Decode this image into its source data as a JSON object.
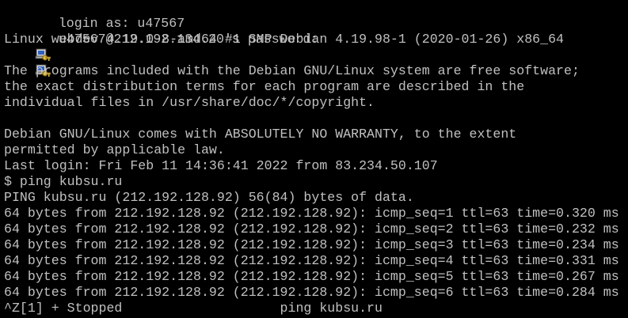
{
  "terminal": {
    "background": "#000000",
    "foreground": "#c0c0c0",
    "login_icon": "key-icon",
    "lines": [
      {
        "text": "login as: u47567",
        "icon": true
      },
      {
        "text": "u47567@212.192.134.20's password:",
        "icon": true
      },
      {
        "text": "Linux webdev 4.19.0-8-amd64 #1 SMP Debian 4.19.98-1 (2020-01-26) x86_64"
      },
      {
        "text": ""
      },
      {
        "text": "The programs included with the Debian GNU/Linux system are free software;"
      },
      {
        "text": "the exact distribution terms for each program are described in the"
      },
      {
        "text": "individual files in /usr/share/doc/*/copyright."
      },
      {
        "text": ""
      },
      {
        "text": "Debian GNU/Linux comes with ABSOLUTELY NO WARRANTY, to the extent"
      },
      {
        "text": "permitted by applicable law."
      },
      {
        "text": "Last login: Fri Feb 11 14:36:41 2022 from 83.234.50.107"
      },
      {
        "text": "$ ping kubsu.ru"
      },
      {
        "text": "PING kubsu.ru (212.192.128.92) 56(84) bytes of data."
      },
      {
        "text": "64 bytes from 212.192.128.92 (212.192.128.92): icmp_seq=1 ttl=63 time=0.320 ms"
      },
      {
        "text": "64 bytes from 212.192.128.92 (212.192.128.92): icmp_seq=2 ttl=63 time=0.232 ms"
      },
      {
        "text": "64 bytes from 212.192.128.92 (212.192.128.92): icmp_seq=3 ttl=63 time=0.234 ms"
      },
      {
        "text": "64 bytes from 212.192.128.92 (212.192.128.92): icmp_seq=4 ttl=63 time=0.331 ms"
      },
      {
        "text": "64 bytes from 212.192.128.92 (212.192.128.92): icmp_seq=5 ttl=63 time=0.267 ms"
      },
      {
        "text": "64 bytes from 212.192.128.92 (212.192.128.92): icmp_seq=6 ttl=63 time=0.284 ms"
      },
      {
        "text": "^Z[1] + Stopped                    ping kubsu.ru"
      }
    ]
  }
}
